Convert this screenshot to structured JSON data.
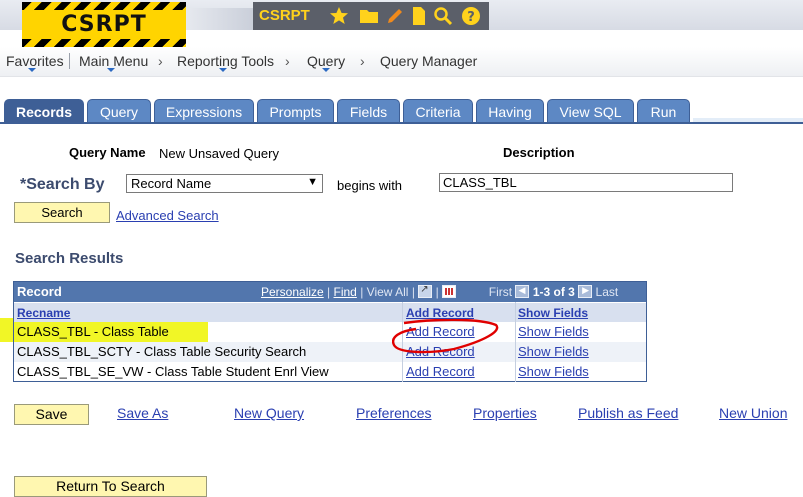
{
  "banner": {
    "logo_text": "CSRPT",
    "title": "CSRPT",
    "icons": [
      "star-icon",
      "folder-icon",
      "pencil-icon",
      "document-icon",
      "search-icon",
      "help-icon"
    ]
  },
  "breadcrumb": {
    "favorites": "Favorites",
    "main_menu": "Main Menu",
    "reporting_tools": "Reporting Tools",
    "query": "Query",
    "query_manager": "Query Manager",
    "sep": "›"
  },
  "tabs": [
    "Records",
    "Query",
    "Expressions",
    "Prompts",
    "Fields",
    "Criteria",
    "Having",
    "View SQL",
    "Run"
  ],
  "form": {
    "query_name_label": "Query Name",
    "query_name_value": "New Unsaved Query",
    "description_label": "Description",
    "search_by_label": "*Search By",
    "search_by_value": "Record Name",
    "begins_with": "begins with",
    "search_value": "CLASS_TBL",
    "search_button": "Search",
    "advanced_search": "Advanced Search"
  },
  "results": {
    "title": "Search Results",
    "grid_title": "Record",
    "personalize": "Personalize",
    "find": "Find",
    "view_all": "View All",
    "first": "First",
    "range": "1-3 of 3",
    "last": "Last",
    "columns": [
      "Recname",
      "Add Record",
      "Show Fields"
    ],
    "rows": [
      {
        "recname": "CLASS_TBL - Class Table",
        "add": "Add Record",
        "show": "Show Fields"
      },
      {
        "recname": "CLASS_TBL_SCTY - Class Table Security Search",
        "add": "Add Record",
        "show": "Show Fields"
      },
      {
        "recname": "CLASS_TBL_SE_VW - Class Table Student Enrl View",
        "add": "Add Record",
        "show": "Show Fields"
      }
    ]
  },
  "footer": {
    "save": "Save",
    "save_as": "Save As",
    "new_query": "New Query",
    "preferences": "Preferences",
    "properties": "Properties",
    "publish_as_feed": "Publish as Feed",
    "new_union": "New Union",
    "return_to_search": "Return To Search"
  },
  "colors": {
    "tab_active": "#3e5f96",
    "tab": "#5d88c4",
    "grid_header": "#5276ad",
    "highlight": "#eff500",
    "annotation": "#e00000",
    "button": "#fff7b0"
  }
}
